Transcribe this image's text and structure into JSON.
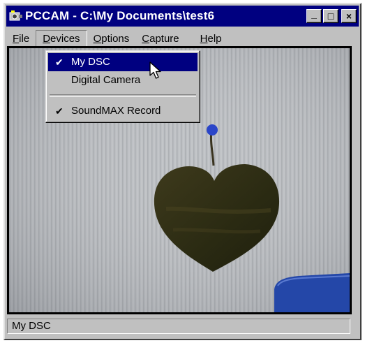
{
  "window": {
    "title": "PCCAM - C:\\My Documents\\test6",
    "controls": {
      "minimize": "_",
      "maximize": "□",
      "close": "×"
    }
  },
  "menubar": {
    "items": [
      {
        "label_u": "F",
        "label_rest": "ile"
      },
      {
        "label_u": "D",
        "label_rest": "evices"
      },
      {
        "label_u": "O",
        "label_rest": "ptions"
      },
      {
        "label_u": "C",
        "label_rest": "apture"
      },
      {
        "label_u": "H",
        "label_rest": "elp"
      }
    ]
  },
  "devices_menu": {
    "items": [
      {
        "label": "My DSC",
        "checked": true
      },
      {
        "label": "Digital Camera",
        "checked": false
      },
      {
        "label": "SoundMAX Record",
        "checked": true
      }
    ],
    "check_glyph": "✔"
  },
  "statusbar": {
    "text": "My DSC"
  },
  "icons": [
    "app-camera-icon",
    "minimize-icon",
    "maximize-icon",
    "close-icon",
    "checkmark-icon",
    "mouse-pointer-icon"
  ]
}
